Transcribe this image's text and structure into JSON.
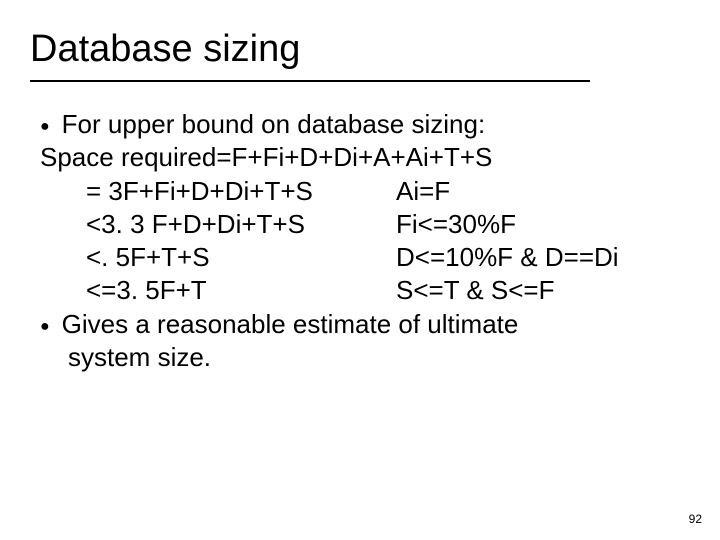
{
  "title": "Database sizing",
  "body": {
    "line1": "For upper bound on database sizing:",
    "line2": "Space required=F+Fi+D+Di+A+Ai+T+S",
    "row3": {
      "left": "= 3F+Fi+D+Di+T+S",
      "right": "Ai=F"
    },
    "row4": {
      "left": "<3. 3 F+D+Di+T+S",
      "right": "Fi<=30%F"
    },
    "row5": {
      "left": "<. 5F+T+S",
      "right": "D<=10%F & D==Di"
    },
    "row6": {
      "left": "<=3. 5F+T",
      "right": "S<=T & S<=F"
    },
    "line7a": "Gives a reasonable estimate of ultimate",
    "line7b": "system size."
  },
  "page": "92"
}
